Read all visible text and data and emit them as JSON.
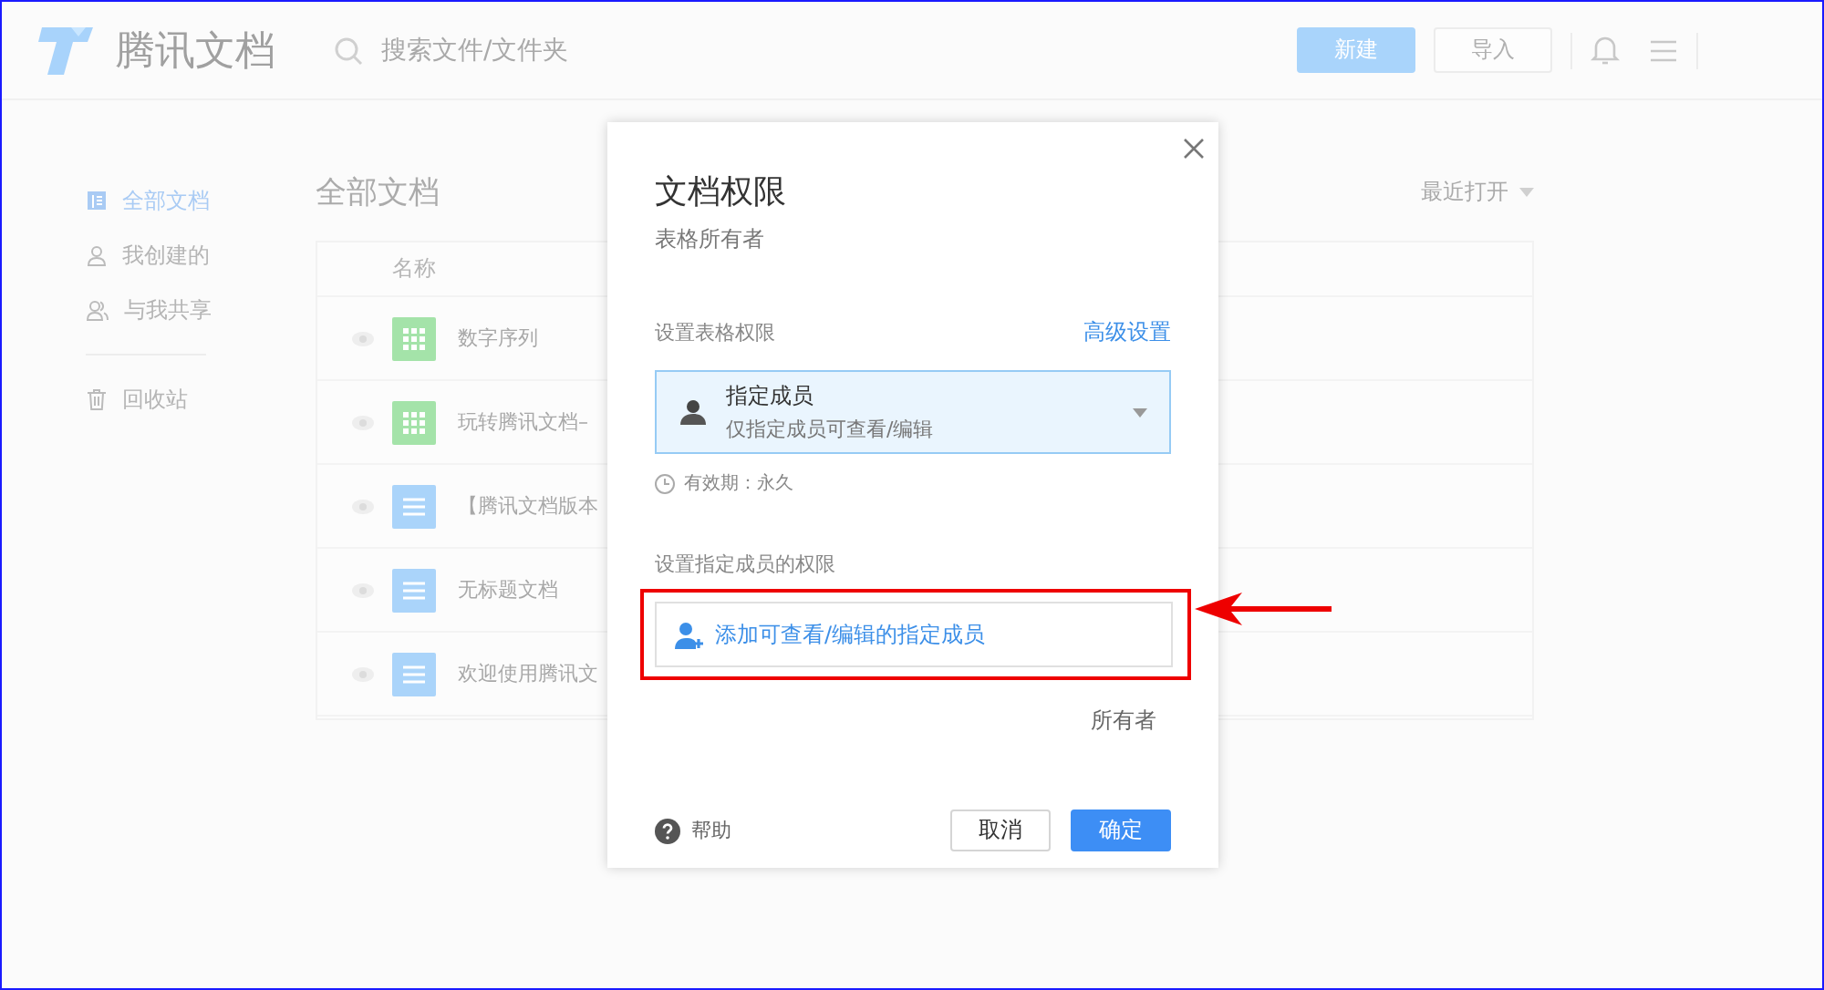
{
  "header": {
    "logo_text": "腾讯文档",
    "search": {
      "placeholder": "搜索文件/文件夹"
    },
    "buttons": [
      {
        "label": "新建",
        "kind": "primary"
      },
      {
        "label": "导入",
        "kind": "default"
      }
    ]
  },
  "sidebar": {
    "sections": [
      {
        "items": [
          {
            "label": "全部文档",
            "selected": true
          },
          {
            "label": "我创建的",
            "selected": false
          },
          {
            "label": "与我共享",
            "selected": false
          }
        ]
      },
      {
        "items": [
          {
            "label": "回收站",
            "selected": false
          }
        ]
      }
    ]
  },
  "main": {
    "title": "全部文档",
    "sort": "最近打开",
    "table": {
      "columns": [
        "名称"
      ],
      "rows": [
        {
          "name": "数字序列",
          "kind": "sheet"
        },
        {
          "name": "玩转腾讯文档–",
          "kind": "sheet"
        },
        {
          "name": "【腾讯文档版本",
          "kind": "doc"
        },
        {
          "name": "无标题文档",
          "kind": "doc"
        },
        {
          "name": "欢迎使用腾讯文",
          "kind": "doc"
        }
      ]
    }
  },
  "dialog": {
    "title": "文档权限",
    "subtitle": "表格所有者",
    "permission_label": "设置表格权限",
    "advanced_link": "高级设置",
    "select": {
      "title": "指定成员",
      "subtitle": "仅指定成员可查看/编辑"
    },
    "expiry": "有效期：永久",
    "members_label": "设置指定成员的权限",
    "add_member": "添加可查看/编辑的指定成员",
    "owner_label": "所有者",
    "help": "帮助",
    "buttons": [
      {
        "label": "取消",
        "kind": "default"
      },
      {
        "label": "确定",
        "kind": "primary"
      }
    ]
  }
}
